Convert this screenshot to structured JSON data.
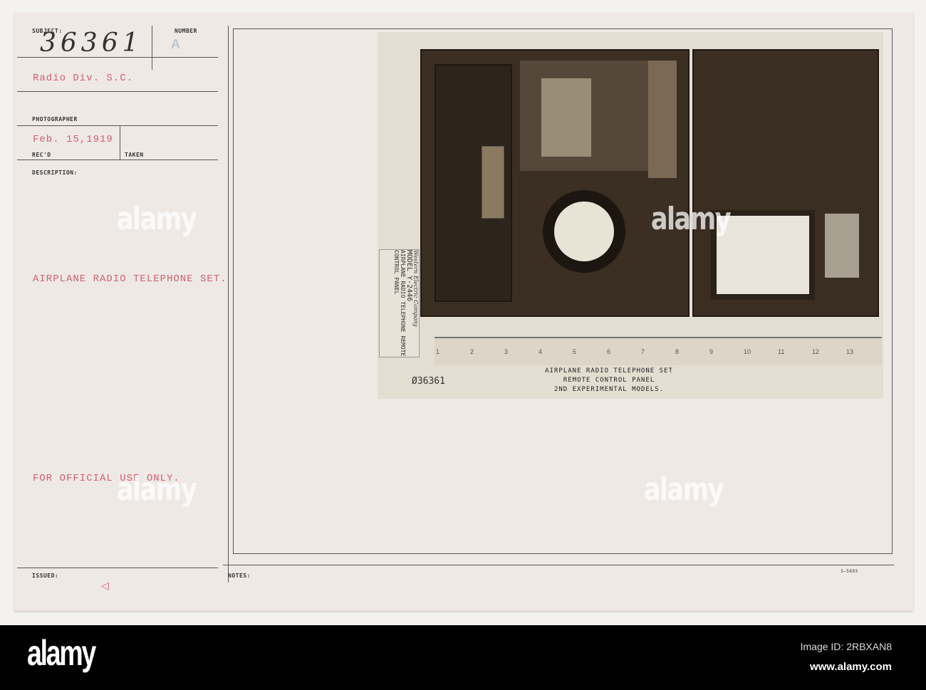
{
  "card": {
    "subject_label": "SUBJECT:",
    "subject_number": "36361",
    "number_label": "NUMBER",
    "number_value": "A",
    "unit": "Radio Div. S.C.",
    "photographer_label": "PHOTOGRAPHER",
    "date": "Feb. 15,1919",
    "recd_label": "REC'D",
    "taken_label": "TAKEN",
    "description_label": "DESCRIPTION:",
    "description": "AIRPLANE RADIO TELEPHONE SET.",
    "restriction": "FOR OFFICIAL USE ONLY.",
    "issued_label": "ISSUED:",
    "notes_label": "NOTES:",
    "form_number": "3—5603"
  },
  "photo": {
    "label_company": "Western Electric Company",
    "label_model": "MODEL Y-2446",
    "label_desc": "AIRPLANE RADIO TELEPHONE REMOTE CONTROL PANEL",
    "ruler_ticks": [
      "1",
      "2",
      "3",
      "4",
      "5",
      "6",
      "7",
      "8",
      "9",
      "10",
      "11",
      "12",
      "13"
    ],
    "negative_number": "Ø36361",
    "caption_line1": "AIRPLANE RADIO TELEPHONE SET",
    "caption_line2": "REMOTE CONTROL PANEL",
    "caption_line3": "2ND EXPERIMENTAL MODELS."
  },
  "watermark": "alamy",
  "footer": {
    "logo": "alamy",
    "image_id": "Image ID: 2RBXAN8",
    "url": "www.alamy.com"
  }
}
